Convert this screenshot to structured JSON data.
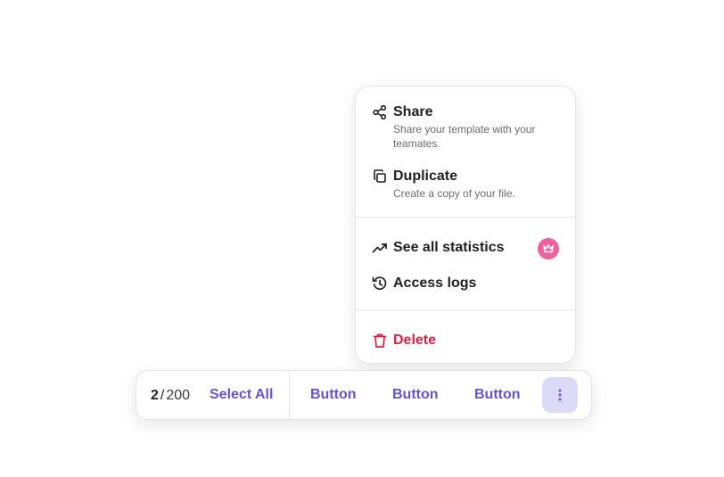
{
  "menu": {
    "share": {
      "title": "Share",
      "description": "Share your template with your teamates.",
      "icon": "share-icon"
    },
    "duplicate": {
      "title": "Duplicate",
      "description": "Create a copy of your file.",
      "icon": "copy-icon"
    },
    "statistics": {
      "title": "See all statistics",
      "icon": "trending-up-icon",
      "badge_icon": "crown-icon"
    },
    "access_logs": {
      "title": "Access logs",
      "icon": "history-icon"
    },
    "delete": {
      "title": "Delete",
      "icon": "trash-icon"
    }
  },
  "toolbar": {
    "selected_count": "2",
    "separator": "/",
    "total_count": "200",
    "select_all_label": "Select All",
    "buttons": [
      "Button",
      "Button",
      "Button"
    ],
    "more_icon": "more-vertical-icon"
  },
  "colors": {
    "accent": "#6850d8",
    "danger": "#dc1f46",
    "badge": "#f0609e",
    "more_button_bg": "#dddaf8"
  }
}
